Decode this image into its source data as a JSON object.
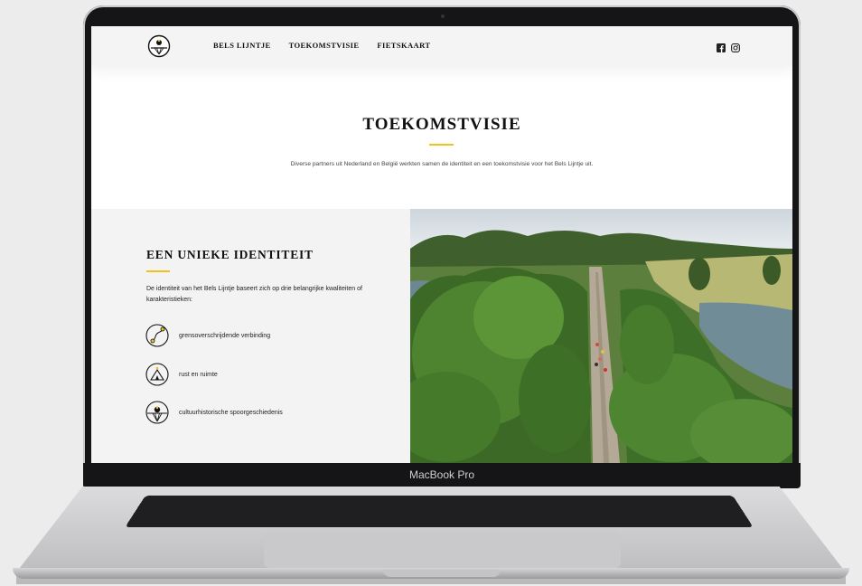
{
  "device": {
    "brand_label": "MacBook Pro"
  },
  "site": {
    "nav": [
      "BELS LIJNTJE",
      "TOEKOMSTVISIE",
      "FIETSKAART"
    ],
    "social": [
      "facebook-icon",
      "instagram-icon"
    ],
    "hero": {
      "title": "TOEKOMSTVISIE",
      "subtitle": "Diverse partners uit Nederland en België werkten samen de identiteit en een toekomstvisie voor het Bels Lijntje uit."
    },
    "identity": {
      "title": "EEN UNIEKE IDENTITEIT",
      "description": "De identiteit van het Bels Lijntje baseert zich op drie belangrijke kwaliteiten of karakteristieken:",
      "features": [
        {
          "label": "grensoverschrijdende verbinding",
          "icon": "route-circle-icon"
        },
        {
          "label": "rust en ruimte",
          "icon": "tent-icon"
        },
        {
          "label": "cultuurhistorische spoorgeschiedenis",
          "icon": "rail-icon"
        }
      ]
    },
    "accent_color": "#f2c21b"
  }
}
